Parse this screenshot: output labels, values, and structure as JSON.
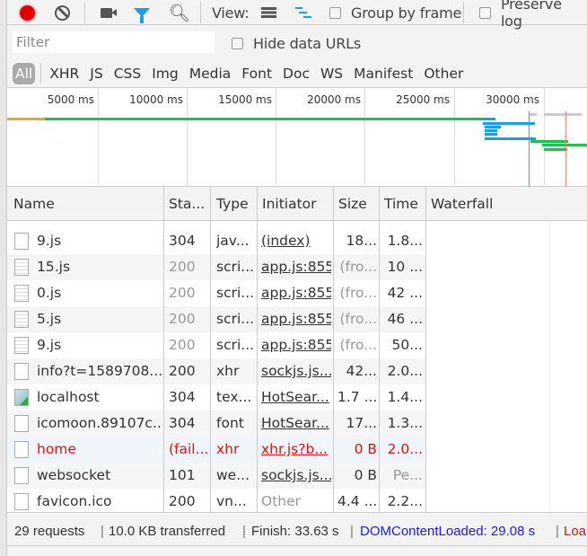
{
  "toolbar": {
    "record_icon": "record-icon",
    "clear_icon": "clear-icon",
    "view_label": "View:",
    "group_by_frame": "Group by frame",
    "preserve_log": "Preserve log",
    "record_color": "#e00000",
    "filter_color": "#1a9cf0"
  },
  "filter": {
    "placeholder": "Filter",
    "hide_data_urls": "Hide data URLs"
  },
  "types": [
    "All",
    "XHR",
    "JS",
    "CSS",
    "Img",
    "Media",
    "Font",
    "Doc",
    "WS",
    "Manifest",
    "Other"
  ],
  "overview": {
    "ticks": [
      "5000 ms",
      "10000 ms",
      "15000 ms",
      "20000 ms",
      "25000 ms",
      "30000 ms"
    ]
  },
  "columns": [
    "Name",
    "Sta...",
    "Type",
    "Initiator",
    "Size",
    "Time",
    "Waterfall"
  ],
  "rows": [
    {
      "name": "9.js",
      "status": "304",
      "type": "jav...",
      "initiator": "(index)",
      "size": "18...",
      "time": "1.8..."
    },
    {
      "name": "15.js",
      "status": "200",
      "type": "scri...",
      "initiator": "app.js:855",
      "size": "(fro...",
      "time": "10 ..."
    },
    {
      "name": "0.js",
      "status": "200",
      "type": "scri...",
      "initiator": "app.js:855",
      "size": "(fro...",
      "time": "42 ..."
    },
    {
      "name": "5.js",
      "status": "200",
      "type": "scri...",
      "initiator": "app.js:855",
      "size": "(fro...",
      "time": "46 ..."
    },
    {
      "name": "9.js",
      "status": "200",
      "type": "scri...",
      "initiator": "app.js:855",
      "size": "(fro...",
      "time": "50..."
    },
    {
      "name": "info?t=1589708...",
      "status": "200",
      "type": "xhr",
      "initiator": "sockjs.js...",
      "size": "42...",
      "time": "2.0..."
    },
    {
      "name": "localhost",
      "status": "304",
      "type": "tex...",
      "initiator": "HotSear...",
      "size": "1.7 ...",
      "time": "1.4..."
    },
    {
      "name": "icomoon.89107c...",
      "status": "304",
      "type": "font",
      "initiator": "HotSear...",
      "size": "17...",
      "time": "1.3..."
    },
    {
      "name": "home",
      "status": "(fail...",
      "type": "xhr",
      "initiator": "xhr.js?b...",
      "size": "0 B",
      "time": "2.0..."
    },
    {
      "name": "websocket",
      "status": "101",
      "type": "we...",
      "initiator": "sockjs.js...",
      "size": "0 B",
      "time": "Pe..."
    },
    {
      "name": "favicon.ico",
      "status": "200",
      "type": "vn...",
      "initiator": "Other",
      "size": "4.4 ...",
      "time": "2.2..."
    }
  ],
  "status": {
    "requests": "29 requests",
    "transferred": "10.0 KB transferred",
    "finish": "Finish: 33.63 s",
    "dcl": "DOMContentLoaded: 29.08 s",
    "load": "Loa"
  }
}
